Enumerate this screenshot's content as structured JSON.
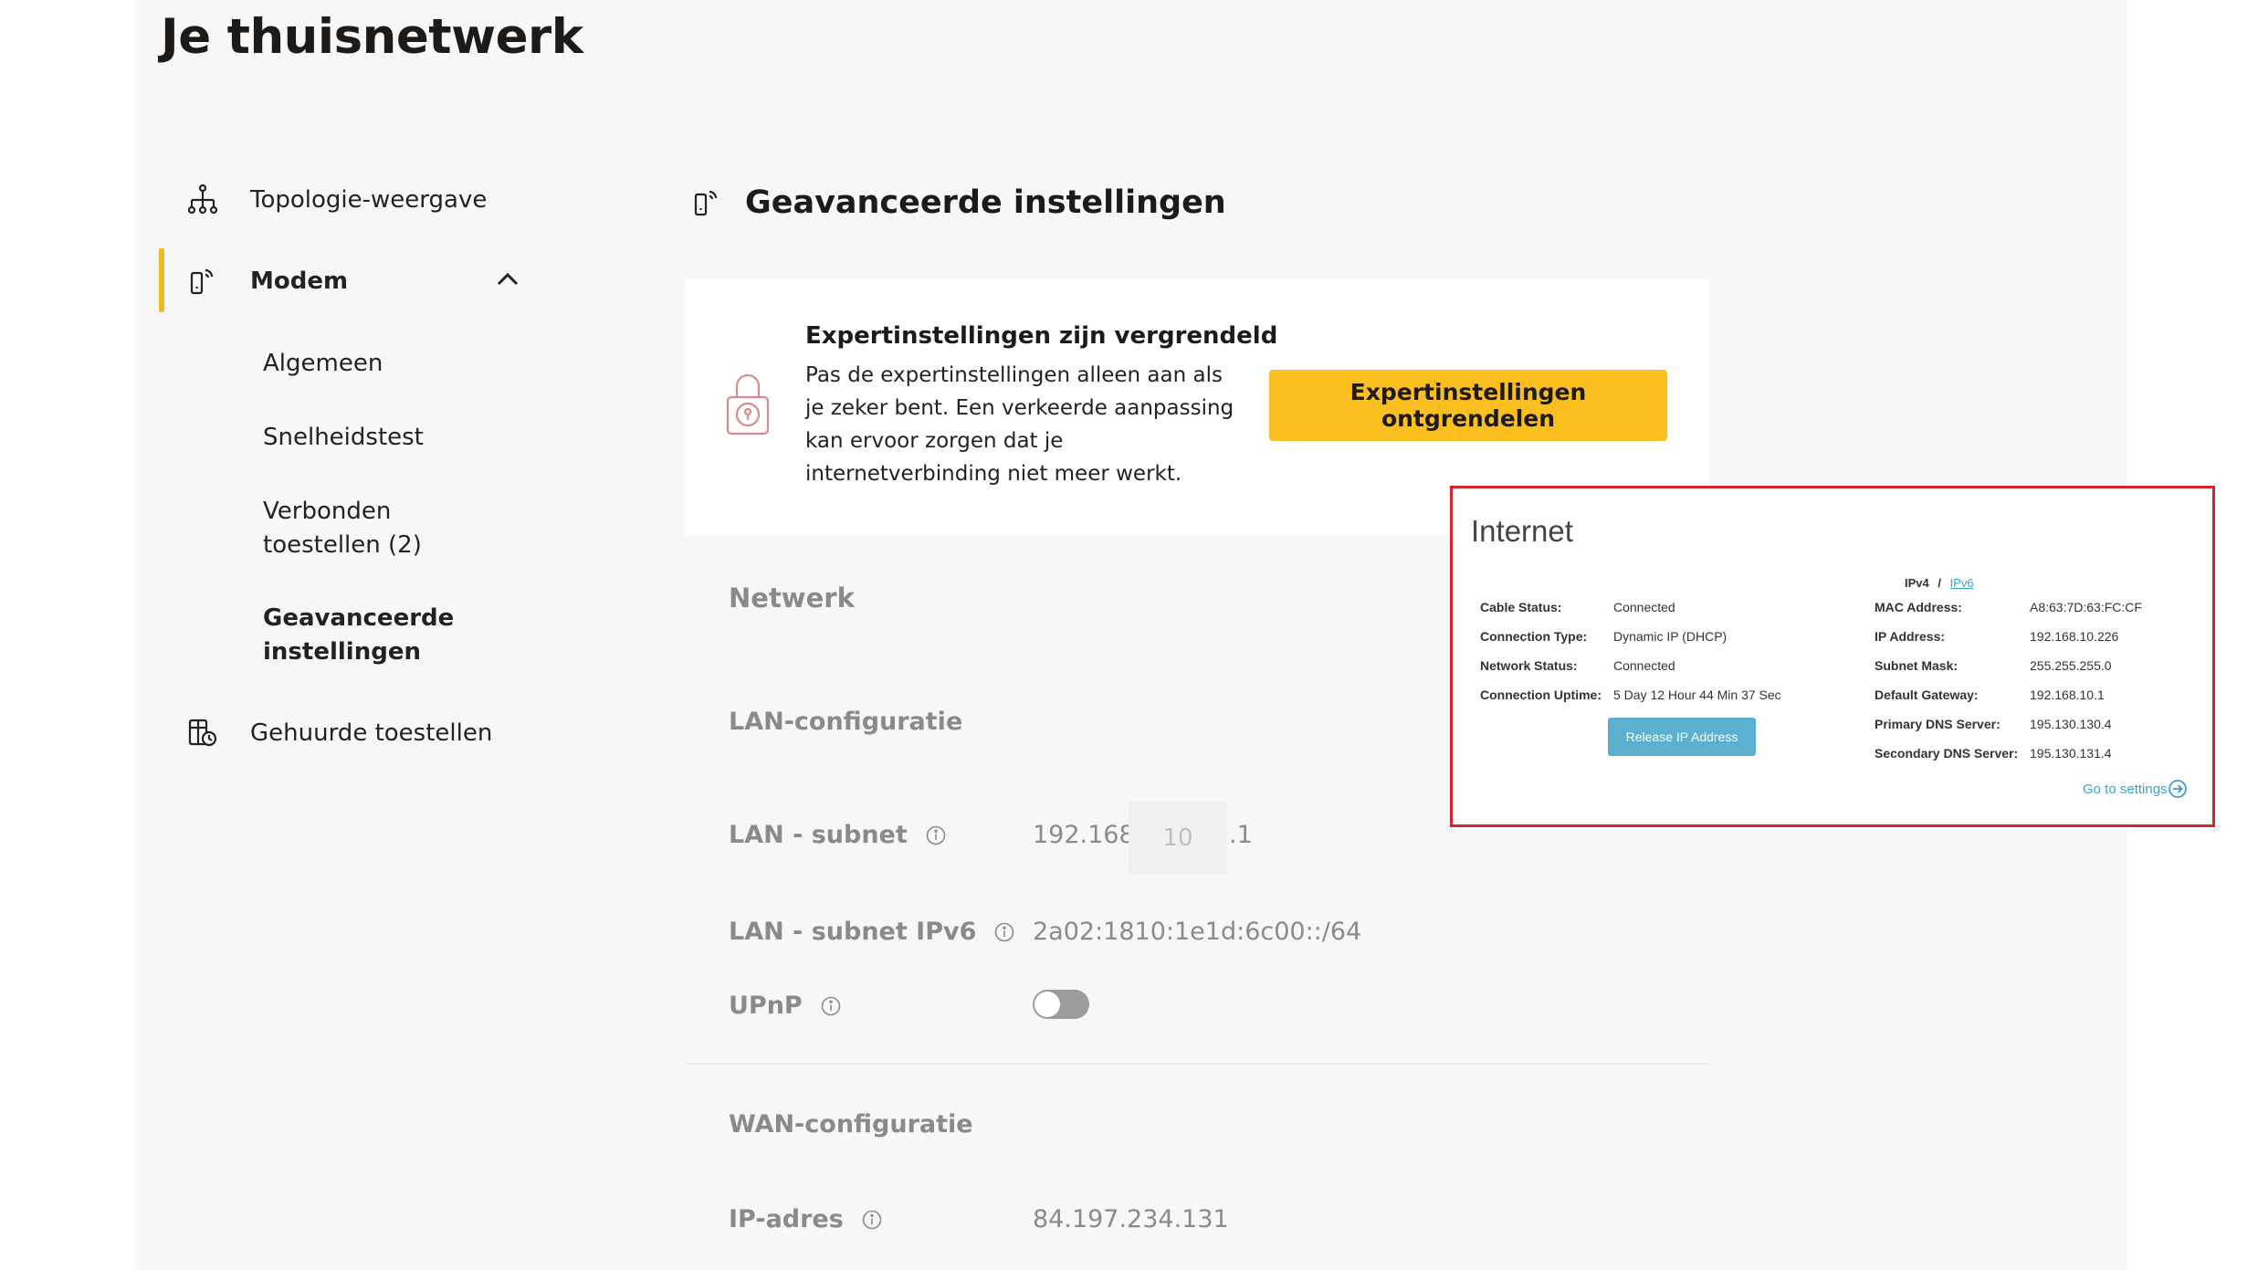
{
  "page_title": "Je thuisnetwerk",
  "sidebar": {
    "items": [
      {
        "label": "Topologie-weergave",
        "icon": "topology-icon"
      },
      {
        "label": "Modem",
        "icon": "modem-icon"
      },
      {
        "label": "Gehuurde toestellen",
        "icon": "rented-devices-icon"
      }
    ],
    "sub_items": [
      {
        "label": "Algemeen"
      },
      {
        "label": "Snelheidstest"
      },
      {
        "label": "Verbonden toestellen (2)"
      },
      {
        "label": "Geavanceerde instellingen"
      }
    ],
    "accent_color": "#f2b81e"
  },
  "section": {
    "title": "Geavanceerde instellingen"
  },
  "locked_card": {
    "heading": "Expertinstellingen zijn vergrendeld",
    "text": "Pas de expertinstellingen alleen aan als je zeker bent. Een verkeerde aanpassing kan ervoor zorgen dat je internetverbinding niet meer werkt.",
    "button_label": "Expertinstellingen ontgrendelen",
    "button_color": "#fbbf1f"
  },
  "network": {
    "heading": "Netwerk",
    "lan_config_heading": "LAN-configuratie",
    "lan_subnet_label": "LAN - subnet",
    "lan_subnet_prefix": "192.168.",
    "lan_subnet_octet": "10",
    "lan_subnet_suffix": ".1",
    "lan_subnet_ipv6_label": "LAN - subnet IPv6",
    "lan_subnet_ipv6_value": "2a02:1810:1e1d:6c00::/64",
    "upnp_label": "UPnP",
    "upnp_enabled": false,
    "wan_config_heading": "WAN-configuratie",
    "ip_label": "IP-adres",
    "ip_value": "84.197.234.131"
  },
  "internet_panel": {
    "title": "Internet",
    "ipv4_label": "IPv4",
    "separator": "/",
    "ipv6_label": "IPv6",
    "left_rows": [
      {
        "label": "Cable Status:",
        "value": "Connected"
      },
      {
        "label": "Connection Type:",
        "value": "Dynamic IP (DHCP)"
      },
      {
        "label": "Network Status:",
        "value": "Connected"
      },
      {
        "label": "Connection Uptime:",
        "value": "5 Day 12 Hour 44 Min 37 Sec"
      }
    ],
    "right_rows": [
      {
        "label": "MAC Address:",
        "value": "A8:63:7D:63:FC:CF"
      },
      {
        "label": "IP Address:",
        "value": "192.168.10.226"
      },
      {
        "label": "Subnet Mask:",
        "value": "255.255.255.0"
      },
      {
        "label": "Default Gateway:",
        "value": "192.168.10.1"
      },
      {
        "label": "Primary DNS Server:",
        "value": "195.130.130.4"
      },
      {
        "label": "Secondary DNS Server:",
        "value": "195.130.131.4"
      }
    ],
    "release_button": "Release IP Address",
    "goto_settings": "Go to settings",
    "border_color": "#d8232a",
    "link_color": "#3a9fd3"
  }
}
